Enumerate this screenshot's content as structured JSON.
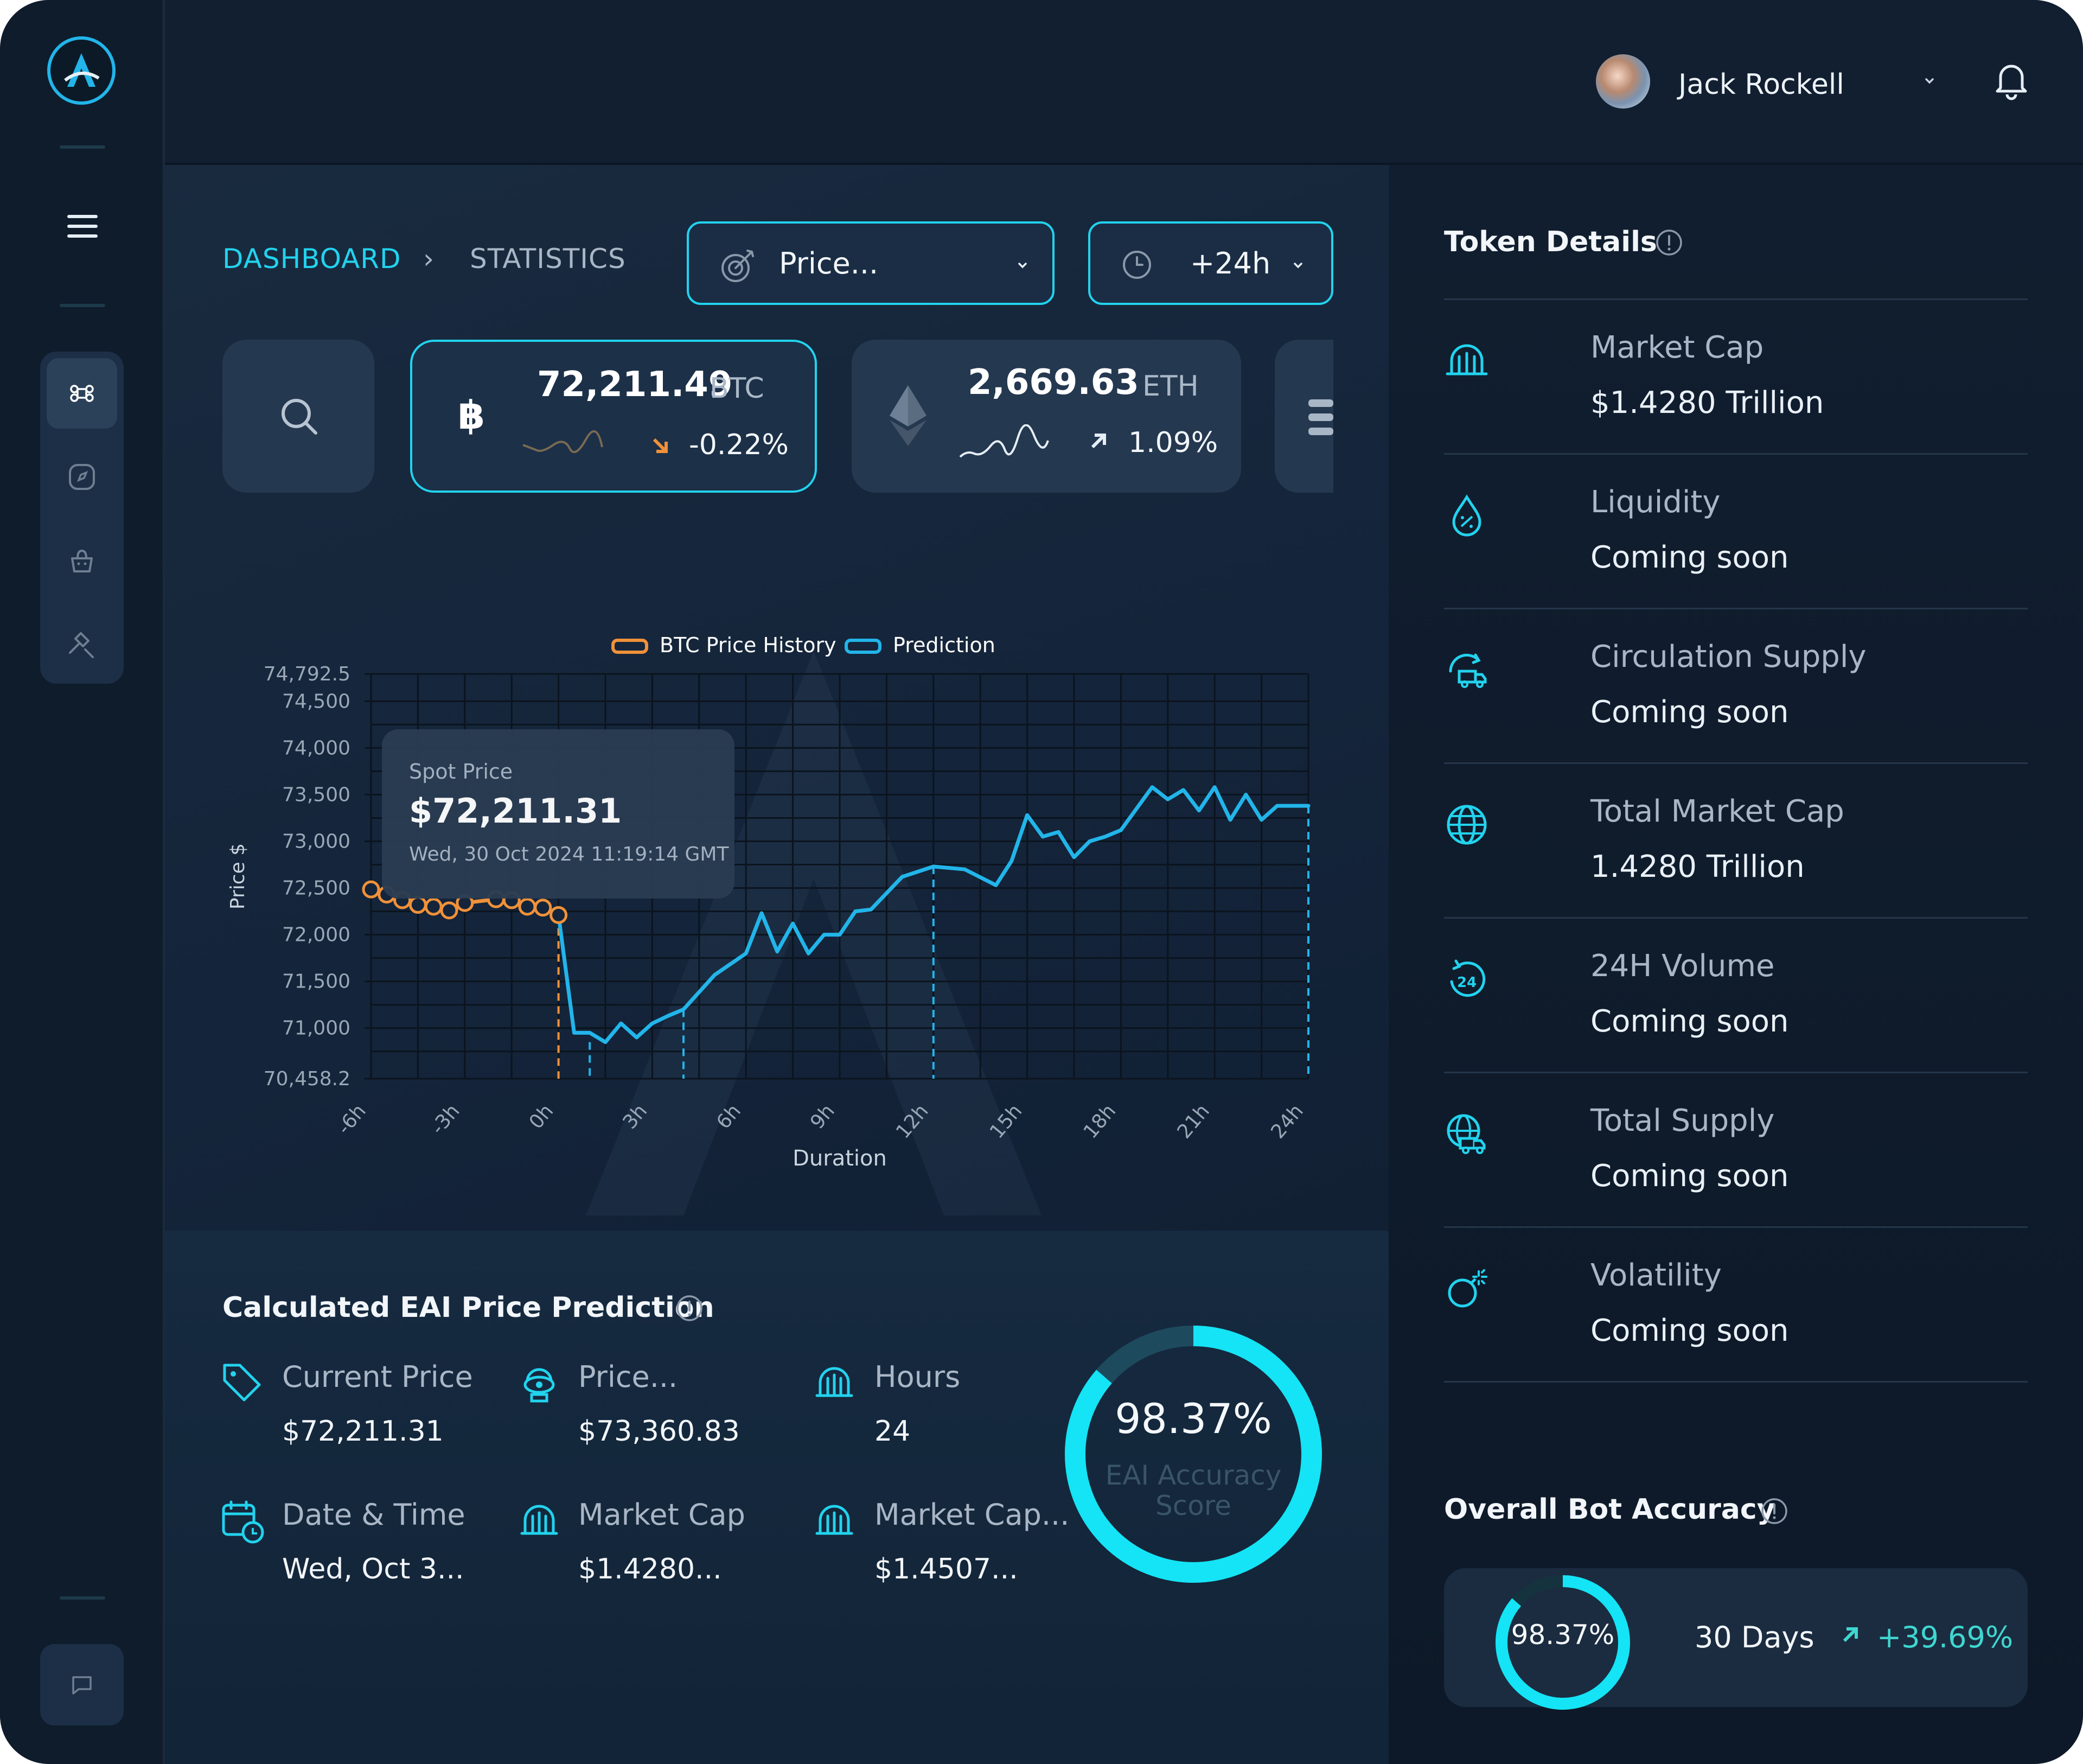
{
  "user": {
    "name": "Jack Rockell"
  },
  "breadcrumb": {
    "root": "DASHBOARD",
    "separator": "›",
    "current": "STATISTICS"
  },
  "filters": {
    "model_select": "Price...",
    "horizon_select": "+24h"
  },
  "tokens": [
    {
      "value": "72,211.49",
      "symbol": "BTC",
      "change": "-0.22%",
      "direction": "down"
    },
    {
      "value": "2,669.63",
      "symbol": "ETH",
      "change": "1.09%",
      "direction": "up"
    }
  ],
  "chart_data": {
    "type": "line",
    "title": "",
    "xlabel": "Duration",
    "ylabel": "Price $",
    "ylim": [
      70458.2,
      74792.5
    ],
    "y_ticks": [
      "74,792.5",
      "74,500",
      "74,000",
      "73,500",
      "73,000",
      "72,500",
      "72,000",
      "71,500",
      "71,000",
      "70,458.2"
    ],
    "x_ticks": [
      "-6h",
      "-3h",
      "0h",
      "3h",
      "6h",
      "9h",
      "12h",
      "15h",
      "18h",
      "21h",
      "24h"
    ],
    "legend": [
      "BTC Price History",
      "Prediction"
    ],
    "series": [
      {
        "name": "BTC Price History",
        "color": "#f0913a",
        "x": [
          -6,
          -5.5,
          -5,
          -4.5,
          -4,
          -3.5,
          -3,
          -2,
          -1.5,
          -1,
          -0.5,
          0
        ],
        "y": [
          72485,
          72430,
          72370,
          72320,
          72300,
          72260,
          72340,
          72380,
          72370,
          72300,
          72290,
          72211
        ]
      },
      {
        "name": "Prediction",
        "color": "#22b5ea",
        "x": [
          0,
          0.5,
          1,
          1.5,
          2,
          2.5,
          3,
          3.5,
          4,
          5,
          6,
          6.5,
          7,
          7.5,
          8,
          8.5,
          9,
          9.5,
          10,
          11,
          12,
          13,
          14,
          14.5,
          15,
          15.5,
          16,
          16.5,
          17,
          17.5,
          18,
          19,
          19.5,
          20,
          20.5,
          21,
          21.5,
          22,
          22.5,
          23,
          23.5,
          24
        ],
        "y": [
          72211,
          70950,
          70950,
          70850,
          71050,
          70900,
          71050,
          71130,
          71200,
          71570,
          71800,
          72230,
          71820,
          72120,
          71800,
          72000,
          72000,
          72250,
          72270,
          72620,
          72730,
          72700,
          72530,
          72790,
          73280,
          73050,
          73100,
          72830,
          73000,
          73050,
          73120,
          73580,
          73450,
          73550,
          73330,
          73580,
          73230,
          73500,
          73230,
          73380,
          73380,
          73380
        ]
      }
    ],
    "tooltip": {
      "label": "Spot Price",
      "value": "$72,211.31",
      "time": "Wed, 30 Oct 2024 11:19:14 GMT"
    },
    "grid": true,
    "legend_position": "top-center"
  },
  "prediction": {
    "title": "Calculated EAI Price Prediction",
    "items": [
      {
        "label": "Current Price",
        "value": "$72,211.31",
        "icon": "tag-icon"
      },
      {
        "label": "Price...",
        "value": "$73,360.83",
        "icon": "robot-icon"
      },
      {
        "label": "Hours",
        "value": "24",
        "icon": "bank-icon"
      },
      {
        "label": "Date & Time",
        "value": "Wed, Oct 3...",
        "icon": "calendar-clock-icon"
      },
      {
        "label": "Market Cap",
        "value": "$1.4280...",
        "icon": "bank-icon"
      },
      {
        "label": "Market Cap...",
        "value": "$1.4507...",
        "icon": "bank-icon"
      }
    ],
    "accuracy": {
      "value": "98.37%",
      "label_line1": "EAI Accuracy",
      "label_line2": "Score",
      "fraction": 0.9837
    }
  },
  "token_details": {
    "title": "Token Details",
    "rows": [
      {
        "label": "Market Cap",
        "value": "$1.4280 Trillion",
        "icon": "bank-icon"
      },
      {
        "label": "Liquidity",
        "value": "Coming soon",
        "icon": "droplet-percent-icon"
      },
      {
        "label": "Circulation Supply",
        "value": "Coming soon",
        "icon": "truck-cycle-icon"
      },
      {
        "label": "Total Market Cap",
        "value": "1.4280 Trillion",
        "icon": "globe-icon"
      },
      {
        "label": "24H Volume",
        "value": "Coming soon",
        "icon": "clock-24-icon"
      },
      {
        "label": "Total Supply",
        "value": "Coming soon",
        "icon": "globe-truck-icon"
      },
      {
        "label": "Volatility",
        "value": "Coming soon",
        "icon": "bomb-icon"
      }
    ]
  },
  "overall_accuracy": {
    "title": "Overall Bot Accuracy",
    "value": "98.37%",
    "fraction": 0.9837,
    "period": "30 Days",
    "change": "+39.69%"
  },
  "colors": {
    "accent": "#22d3ee",
    "orange": "#f0913a",
    "up": "#3fd6d0",
    "background": "#14243a"
  }
}
